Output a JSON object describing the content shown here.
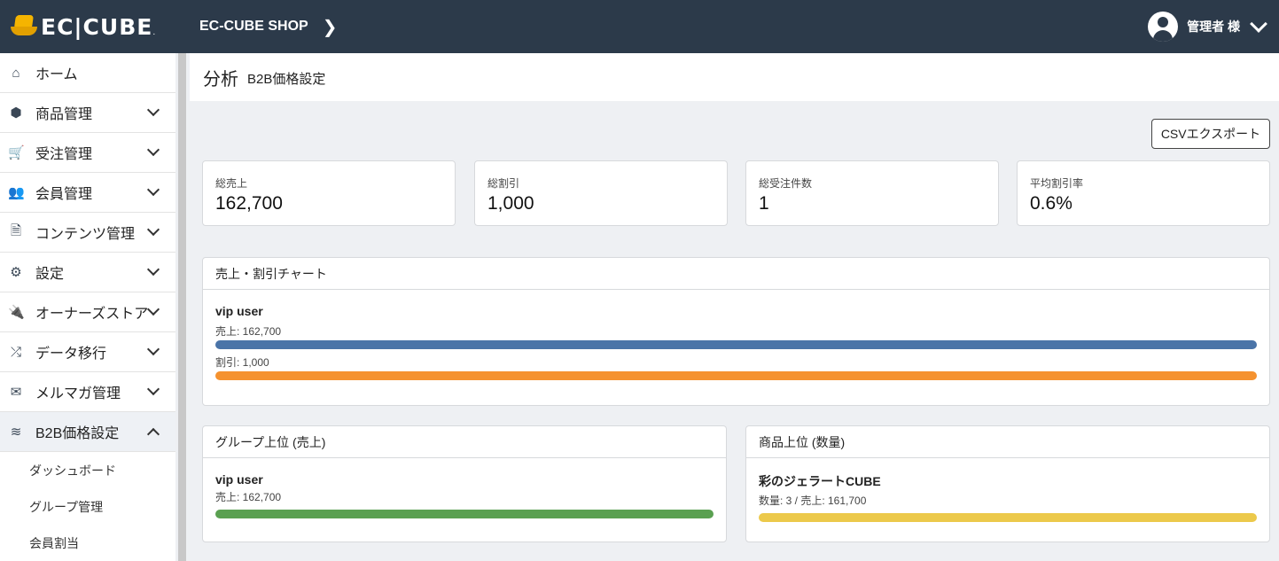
{
  "header": {
    "logo_text": "EC|CUBE",
    "logo_mark": ".",
    "shop_name": "EC-CUBE SHOP",
    "user_label": "管理者 様"
  },
  "sidebar": {
    "items": [
      {
        "label": "ホーム",
        "icon": "home-icon",
        "glyph": "⌂"
      },
      {
        "label": "商品管理",
        "icon": "box-icon",
        "glyph": "⬢"
      },
      {
        "label": "受注管理",
        "icon": "cart-icon",
        "glyph": "🛒"
      },
      {
        "label": "会員管理",
        "icon": "users-icon",
        "glyph": "👥"
      },
      {
        "label": "コンテンツ管理",
        "icon": "file-icon",
        "glyph": "🗎"
      },
      {
        "label": "設定",
        "icon": "gear-icon",
        "glyph": "⚙"
      },
      {
        "label": "オーナーズストア",
        "icon": "plug-icon",
        "glyph": "🔌"
      },
      {
        "label": "データ移行",
        "icon": "shuffle-icon",
        "glyph": "⤮"
      },
      {
        "label": "メルマガ管理",
        "icon": "envelope-icon",
        "glyph": "✉"
      },
      {
        "label": "B2B価格設定",
        "icon": "layers-icon",
        "glyph": "≋"
      }
    ],
    "sub_items": [
      "ダッシュボード",
      "グループ管理",
      "会員割当"
    ]
  },
  "page": {
    "title": "分析",
    "subtitle": "B2B価格設定",
    "csv_button": "CSVエクスポート"
  },
  "stats": [
    {
      "label": "総売上",
      "value": "162,700"
    },
    {
      "label": "総割引",
      "value": "1,000"
    },
    {
      "label": "総受注件数",
      "value": "1"
    },
    {
      "label": "平均割引率",
      "value": "0.6%"
    }
  ],
  "sales_chart": {
    "title": "売上・割引チャート",
    "group": "vip user",
    "sales_label": "売上: 162,700",
    "discount_label": "割引: 1,000",
    "sales_fraction": 1.0,
    "discount_fraction": 1.0,
    "sales_color": "#4a74a8",
    "discount_color": "#f5922f"
  },
  "group_top": {
    "title": "グループ上位 (売上)",
    "name": "vip user",
    "detail": "売上: 162,700",
    "fraction": 1.0,
    "color": "#5aa051"
  },
  "product_top": {
    "title": "商品上位 (数量)",
    "name": "彩のジェラートCUBE",
    "detail": "数量: 3 / 売上: 161,700",
    "fraction": 1.0,
    "color": "#ecc94b"
  }
}
